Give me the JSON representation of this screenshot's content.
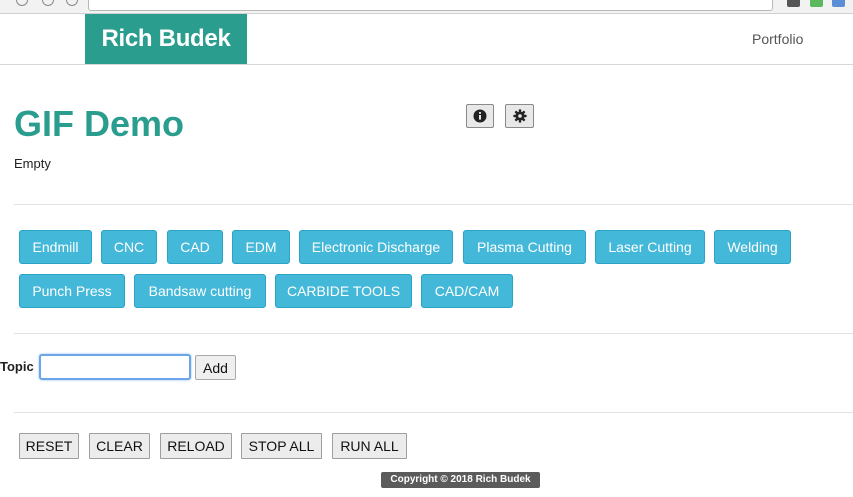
{
  "navbar": {
    "brand": "Rich Budek",
    "links": [
      "Portfolio"
    ]
  },
  "page": {
    "title": "GIF Demo",
    "status": "Empty",
    "icons": [
      "info-icon",
      "gear-icon"
    ]
  },
  "topics": [
    "Endmill",
    "CNC",
    "CAD",
    "EDM",
    "Electronic Discharge",
    "Plasma Cutting",
    "Laser Cutting",
    "Welding",
    "Punch Press",
    "Bandsaw cutting",
    "CARBIDE TOOLS",
    "CAD/CAM"
  ],
  "form": {
    "label": "Topic",
    "value": "",
    "add_label": "Add"
  },
  "controls": {
    "reset": "RESET",
    "clear": "CLEAR",
    "reload": "RELOAD",
    "stop_all": "STOP ALL",
    "run_all": "RUN ALL"
  },
  "footer": {
    "copyright": "Copyright © 2018 Rich Budek"
  },
  "colors": {
    "brand": "#2a9d8f",
    "topic_button": "#44b8d8"
  }
}
